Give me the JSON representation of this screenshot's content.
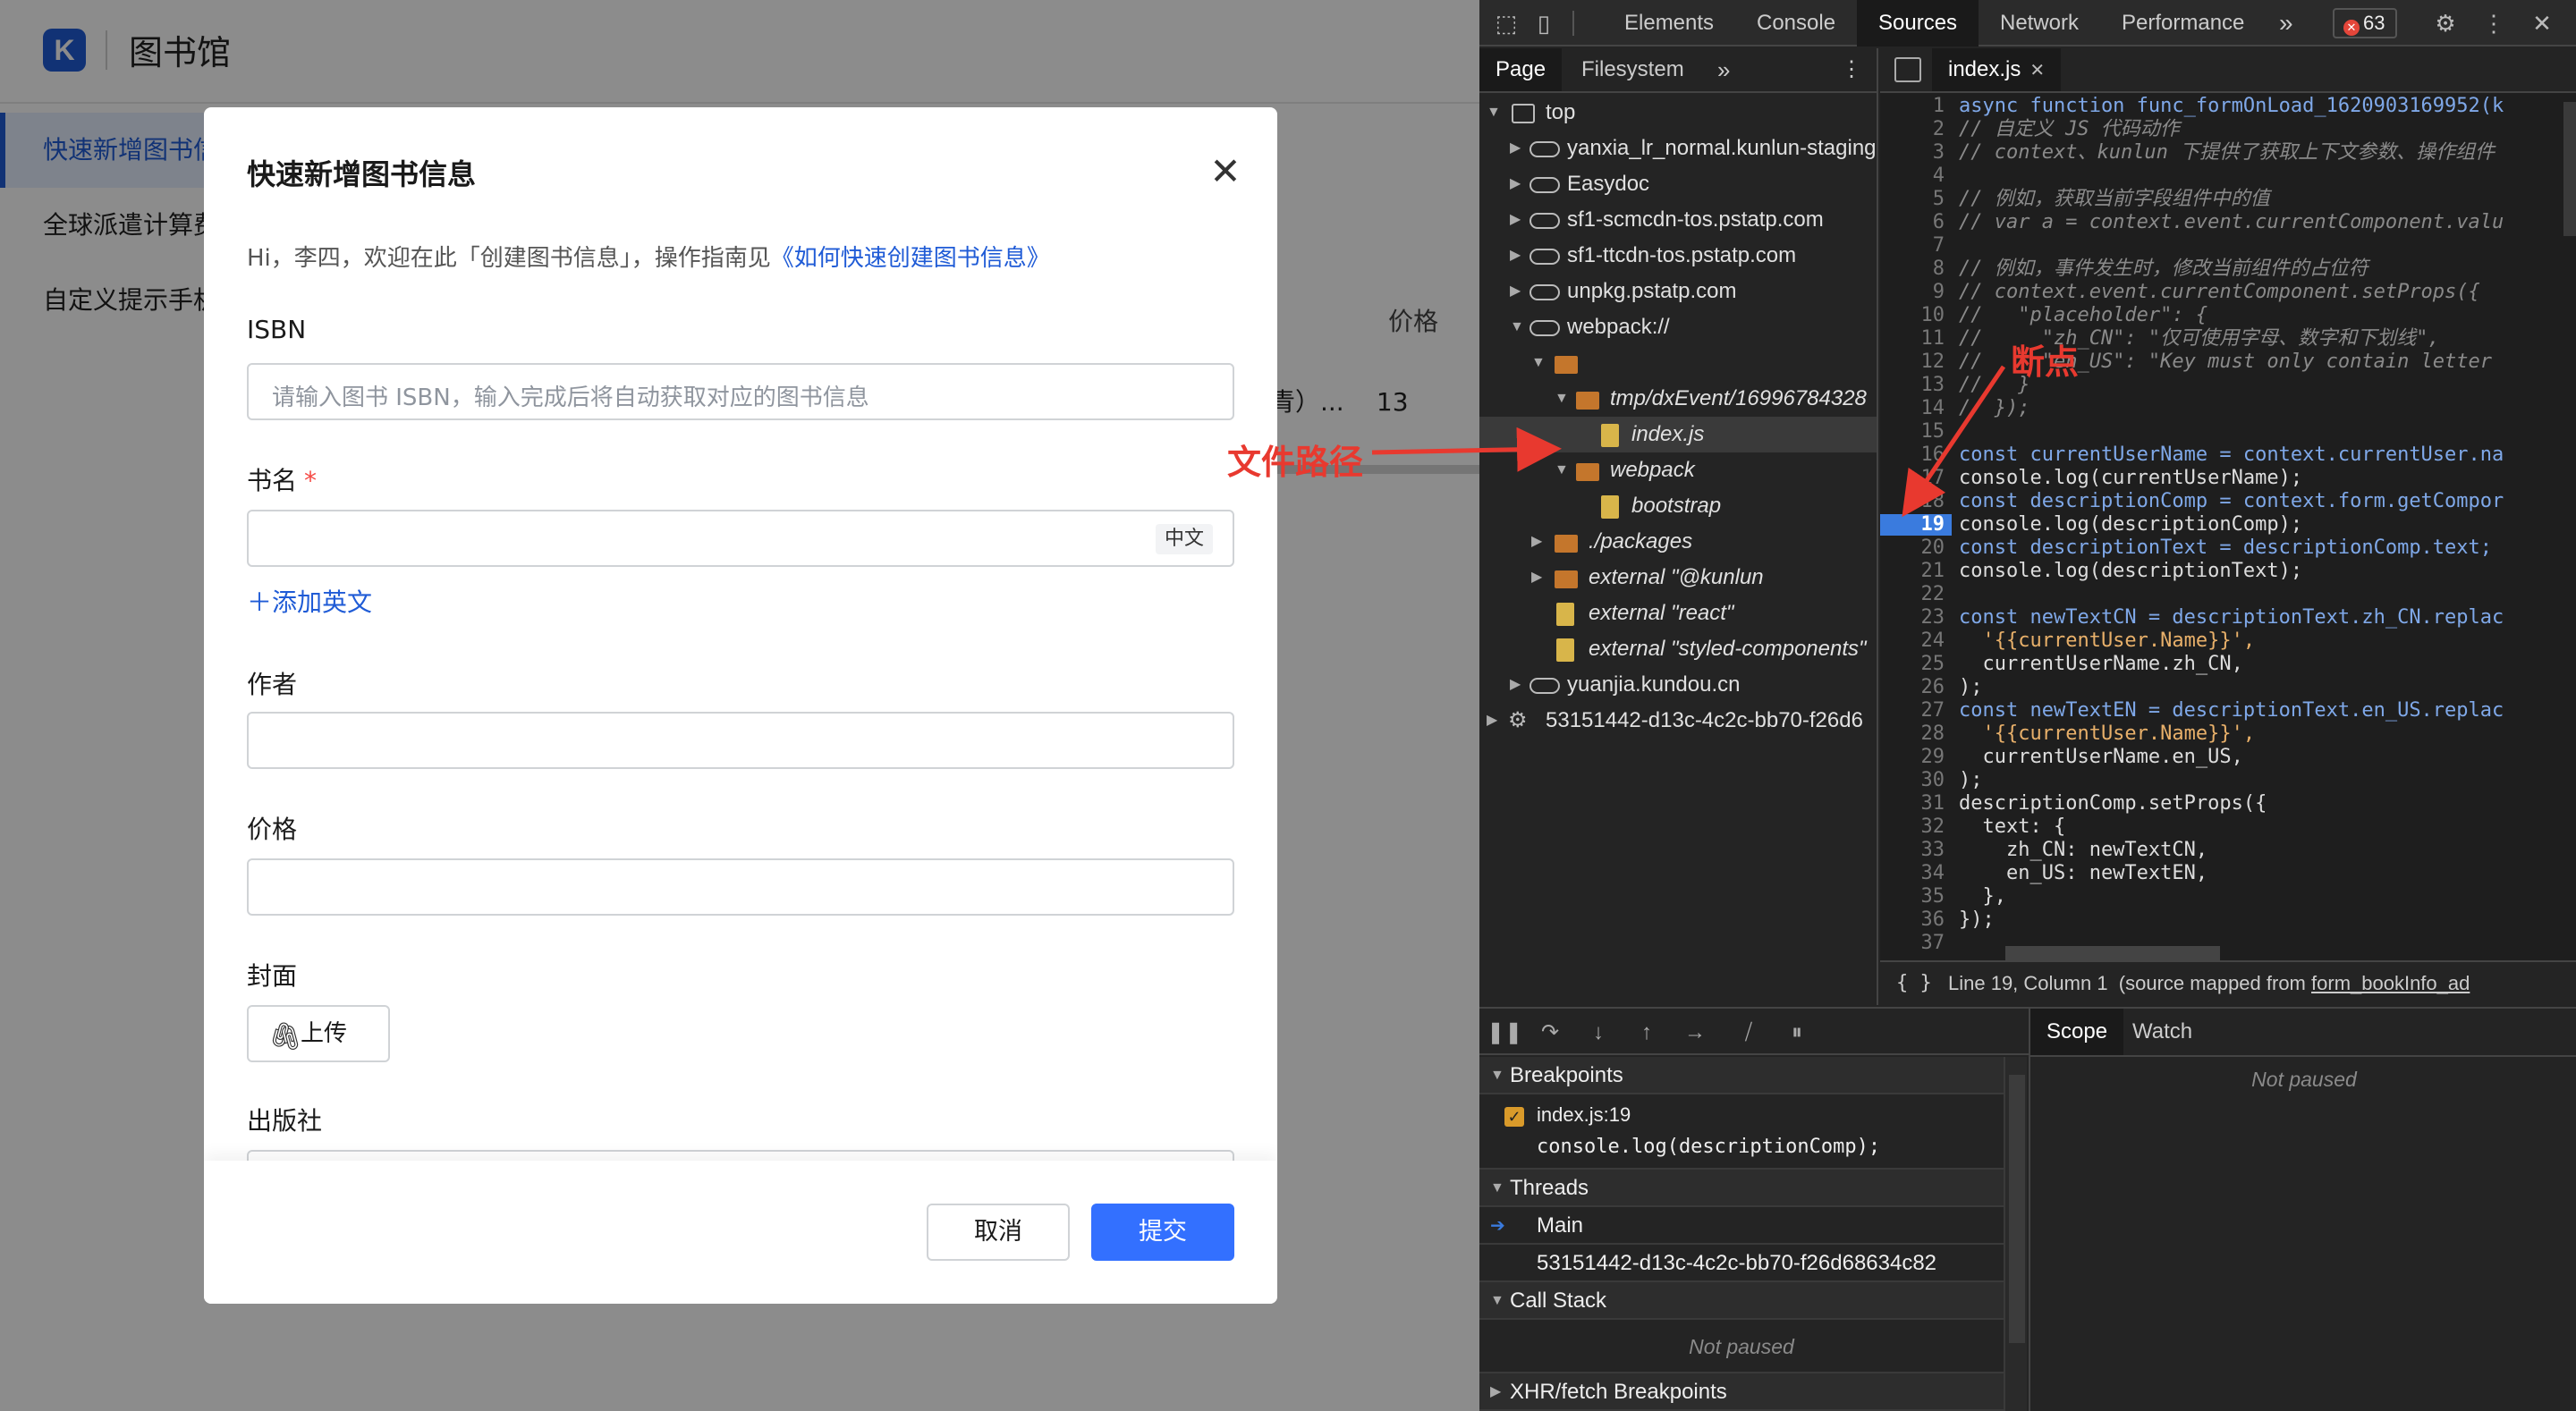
{
  "app": {
    "logo_letter": "K",
    "title": "图书馆",
    "sidebar": [
      {
        "label": "快速新增图书信息"
      },
      {
        "label": "全球派遣计算费用"
      },
      {
        "label": "自定义提示手机号"
      }
    ],
    "table": {
      "price_header": "价格",
      "row_ellipsis": "青）...",
      "row_price": "13"
    }
  },
  "modal": {
    "title": "快速新增图书信息",
    "welcome_text": "Hi，李四，欢迎在此「创建图书信息」，操作指南见",
    "welcome_link": "《如何快速创建图书信息》",
    "isbn_label": "ISBN",
    "isbn_placeholder": "请输入图书 ISBN，输入完成后将自动获取对应的图书信息",
    "name_label": "书名",
    "required_mark": "*",
    "lang_tag": "中文",
    "add_english": "添加英文",
    "author_label": "作者",
    "price_label": "价格",
    "cover_label": "封面",
    "upload_label": "上传",
    "publisher_label": "出版社",
    "cancel_label": "取消",
    "submit_label": "提交"
  },
  "devtools": {
    "tabs": [
      "Elements",
      "Console",
      "Sources",
      "Network",
      "Performance"
    ],
    "active_tab": "Sources",
    "error_count": "63",
    "navigator_tabs": [
      "Page",
      "Filesystem"
    ],
    "tree": [
      {
        "label": "top",
        "icon": "frame-icon"
      },
      {
        "label": "yanxia_lr_normal.kunlun-staging",
        "icon": "cloud-icon"
      },
      {
        "label": "Easydoc",
        "icon": "cloud-icon"
      },
      {
        "label": "sf1-scmcdn-tos.pstatp.com",
        "icon": "cloud-icon"
      },
      {
        "label": "sf1-ttcdn-tos.pstatp.com",
        "icon": "cloud-icon"
      },
      {
        "label": "unpkg.pstatp.com",
        "icon": "cloud-icon"
      },
      {
        "label": "webpack://",
        "icon": "cloud-icon"
      },
      {
        "label": "",
        "icon": "folder-icon"
      },
      {
        "label": "tmp/dxEvent/16996784328",
        "icon": "folder-icon"
      },
      {
        "label": "index.js",
        "icon": "file-icon"
      },
      {
        "label": "webpack",
        "icon": "folder-icon"
      },
      {
        "label": "bootstrap",
        "icon": "file-icon"
      },
      {
        "label": "./packages",
        "icon": "folder-icon"
      },
      {
        "label": "external \"@kunlun",
        "icon": "folder-icon"
      },
      {
        "label": "external \"react\"",
        "icon": "file-icon"
      },
      {
        "label": "external \"styled-components\"",
        "icon": "file-icon"
      },
      {
        "label": "yuanjia.kundou.cn",
        "icon": "cloud-icon"
      },
      {
        "label": "53151442-d13c-4c2c-bb70-f26d6",
        "icon": "gear-icon"
      }
    ],
    "editor_tab": "index.js",
    "code_lines": [
      {
        "n": "1",
        "t": "async function func_formOnLoad_1620903169952(k"
      },
      {
        "n": "2",
        "t": "// 自定义 JS 代码动作"
      },
      {
        "n": "3",
        "t": "// context、kunlun 下提供了获取上下文参数、操作组件"
      },
      {
        "n": "4",
        "t": ""
      },
      {
        "n": "5",
        "t": "// 例如，获取当前字段组件中的值"
      },
      {
        "n": "6",
        "t": "// var a = context.event.currentComponent.valu"
      },
      {
        "n": "7",
        "t": ""
      },
      {
        "n": "8",
        "t": "// 例如，事件发生时，修改当前组件的占位符"
      },
      {
        "n": "9",
        "t": "// context.event.currentComponent.setProps({"
      },
      {
        "n": "10",
        "t": "//   \"placeholder\": {"
      },
      {
        "n": "11",
        "t": "//     \"zh_CN\": \"仅可使用字母、数字和下划线\","
      },
      {
        "n": "12",
        "t": "//     \"en_US\": \"Key must only contain letter"
      },
      {
        "n": "13",
        "t": "//   }"
      },
      {
        "n": "14",
        "t": "// });"
      },
      {
        "n": "15",
        "t": ""
      },
      {
        "n": "16",
        "t": "const currentUserName = context.currentUser.na"
      },
      {
        "n": "17",
        "t": "console.log(currentUserName);"
      },
      {
        "n": "18",
        "t": "const descriptionComp = context.form.getCompor"
      },
      {
        "n": "19",
        "t": "console.log(descriptionComp);"
      },
      {
        "n": "20",
        "t": "const descriptionText = descriptionComp.text;"
      },
      {
        "n": "21",
        "t": "console.log(descriptionText);"
      },
      {
        "n": "22",
        "t": ""
      },
      {
        "n": "23",
        "t": "const newTextCN = descriptionText.zh_CN.replac"
      },
      {
        "n": "24",
        "t": "  '{{currentUser.Name}}',"
      },
      {
        "n": "25",
        "t": "  currentUserName.zh_CN,"
      },
      {
        "n": "26",
        "t": ");"
      },
      {
        "n": "27",
        "t": "const newTextEN = descriptionText.en_US.replac"
      },
      {
        "n": "28",
        "t": "  '{{currentUser.Name}}',"
      },
      {
        "n": "29",
        "t": "  currentUserName.en_US,"
      },
      {
        "n": "30",
        "t": ");"
      },
      {
        "n": "31",
        "t": "descriptionComp.setProps({"
      },
      {
        "n": "32",
        "t": "  text: {"
      },
      {
        "n": "33",
        "t": "    zh_CN: newTextCN,"
      },
      {
        "n": "34",
        "t": "    en_US: newTextEN,"
      },
      {
        "n": "35",
        "t": "  },"
      },
      {
        "n": "36",
        "t": "});"
      },
      {
        "n": "37",
        "t": ""
      }
    ],
    "breakpoint_line": "19",
    "status": {
      "position": "Line 19, Column 1",
      "mapped_prefix": "(source mapped from",
      "mapped_file": "form_bookInfo_ad"
    },
    "debugger": {
      "breakpoints_header": "Breakpoints",
      "bp_file": "index.js:19",
      "bp_code": "console.log(descriptionComp);",
      "threads_header": "Threads",
      "thread_main": "Main",
      "thread_worker": "53151442-d13c-4c2c-bb70-f26d68634c82",
      "callstack_header": "Call Stack",
      "not_paused": "Not paused",
      "xhr_header": "XHR/fetch Breakpoints",
      "scope_tab": "Scope",
      "watch_tab": "Watch",
      "scope_not_paused": "Not paused"
    }
  },
  "annotations": {
    "breakpoint": "断点",
    "file_path": "文件路径",
    "color": "#e8392f"
  }
}
